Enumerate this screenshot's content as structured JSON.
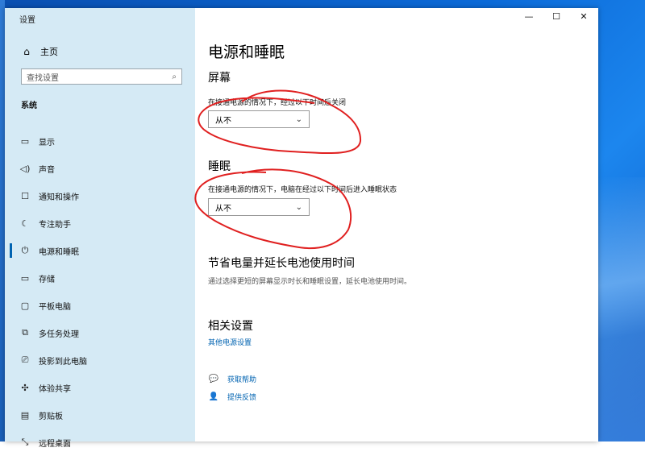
{
  "window": {
    "title": "设置",
    "controls": {
      "minimize": "—",
      "maximize": "☐",
      "close": "✕"
    }
  },
  "sidebar": {
    "home_label": "主页",
    "search_placeholder": "查找设置",
    "section_label": "系统",
    "items": [
      {
        "label": "显示",
        "icon": "monitor-icon",
        "glyph": "▭"
      },
      {
        "label": "声音",
        "icon": "speaker-icon",
        "glyph": "🔈"
      },
      {
        "label": "通知和操作",
        "icon": "notification-icon",
        "glyph": "☐"
      },
      {
        "label": "专注助手",
        "icon": "moon-icon",
        "glyph": "☾"
      },
      {
        "label": "电源和睡眠",
        "icon": "power-icon",
        "glyph": "⏻"
      },
      {
        "label": "存储",
        "icon": "storage-icon",
        "glyph": "▭"
      },
      {
        "label": "平板电脑",
        "icon": "tablet-icon",
        "glyph": "▢"
      },
      {
        "label": "多任务处理",
        "icon": "multitask-icon",
        "glyph": "⧉"
      },
      {
        "label": "投影到此电脑",
        "icon": "project-icon",
        "glyph": "⎚"
      },
      {
        "label": "体验共享",
        "icon": "share-icon",
        "glyph": "✣"
      },
      {
        "label": "剪贴板",
        "icon": "clipboard-icon",
        "glyph": "📋"
      },
      {
        "label": "远程桌面",
        "icon": "remote-icon",
        "glyph": "✕"
      }
    ]
  },
  "main": {
    "title": "电源和睡眠",
    "screen": {
      "heading": "屏幕",
      "description": "在接通电源的情况下，经过以下时间后关闭",
      "value": "从不"
    },
    "sleep": {
      "heading": "睡眠",
      "description": "在接通电源的情况下，电脑在经过以下时间后进入睡眠状态",
      "value": "从不"
    },
    "battery": {
      "heading": "节省电量并延长电池使用时间",
      "description": "通过选择更短的屏幕显示时长和睡眠设置，延长电池使用时间。"
    },
    "related": {
      "heading": "相关设置",
      "link": "其他电源设置"
    },
    "help": {
      "get_help": "获取帮助",
      "feedback": "提供反馈"
    }
  },
  "colors": {
    "accent": "#0063b1",
    "sidebar_bg": "#d5eaf5",
    "annotation": "#e02020"
  }
}
